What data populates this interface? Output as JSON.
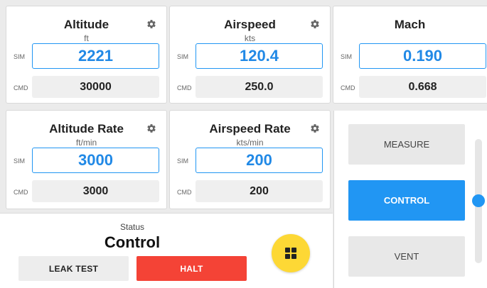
{
  "panels": [
    {
      "title": "Altitude",
      "unit": "ft",
      "sim_label": "SIM",
      "sim_value": "2221",
      "cmd_label": "CMD",
      "cmd_value": "30000",
      "has_gear": true
    },
    {
      "title": "Airspeed",
      "unit": "kts",
      "sim_label": "SIM",
      "sim_value": "120.4",
      "cmd_label": "CMD",
      "cmd_value": "250.0",
      "has_gear": true
    },
    {
      "title": "Mach",
      "unit": "",
      "sim_label": "SIM",
      "sim_value": "0.190",
      "cmd_label": "CMD",
      "cmd_value": "0.668",
      "has_gear": false
    },
    {
      "title": "Altitude Rate",
      "unit": "ft/min",
      "sim_label": "SIM",
      "sim_value": "3000",
      "cmd_label": "CMD",
      "cmd_value": "3000",
      "has_gear": true
    },
    {
      "title": "Airspeed Rate",
      "unit": "kts/min",
      "sim_label": "SIM",
      "sim_value": "200",
      "cmd_label": "CMD",
      "cmd_value": "200",
      "has_gear": true
    }
  ],
  "status": {
    "label": "Status",
    "value": "Control",
    "leak_test_label": "LEAK TEST",
    "halt_label": "HALT"
  },
  "fab_icon": "grid-icon",
  "modes": {
    "measure_label": "MEASURE",
    "control_label": "CONTROL",
    "vent_label": "VENT",
    "selected": "CONTROL",
    "slider_level": 0.5
  },
  "colors": {
    "accent": "#2196f3",
    "halt": "#f44336",
    "fab": "#fdd835"
  }
}
